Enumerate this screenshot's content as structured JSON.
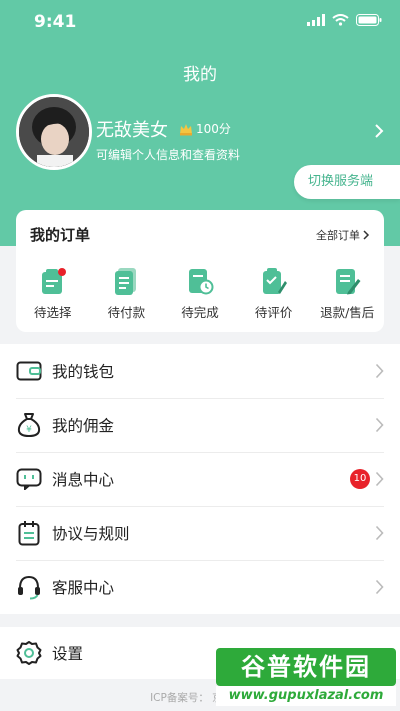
{
  "status_bar": {
    "time": "9:41"
  },
  "header": {
    "title": "我的"
  },
  "profile": {
    "name": "无敌美女",
    "points": "100分",
    "subtitle": "可编辑个人信息和查看资料"
  },
  "switch_button": "切换服务端",
  "orders": {
    "title": "我的订单",
    "all_label": "全部订单",
    "items": [
      {
        "label": "待选择",
        "icon": "pending-select-icon"
      },
      {
        "label": "待付款",
        "icon": "pending-payment-icon"
      },
      {
        "label": "待完成",
        "icon": "pending-complete-icon"
      },
      {
        "label": "待评价",
        "icon": "pending-review-icon"
      },
      {
        "label": "退款/售后",
        "icon": "refund-icon"
      }
    ]
  },
  "menu": {
    "items": [
      {
        "label": "我的钱包",
        "icon": "wallet-icon"
      },
      {
        "label": "我的佣金",
        "icon": "money-bag-icon"
      },
      {
        "label": "消息中心",
        "icon": "message-icon",
        "badge": "10"
      },
      {
        "label": "协议与规则",
        "icon": "calendar-icon"
      },
      {
        "label": "客服中心",
        "icon": "headset-icon"
      }
    ]
  },
  "settings": {
    "label": "设置",
    "icon": "gear-icon"
  },
  "footer": {
    "icp": "ICP备案号： 京ICP备"
  },
  "watermark": {
    "top": "谷普软件园",
    "bottom": "www.gupuxlazal.com"
  },
  "colors": {
    "accent": "#62c9a6",
    "badge": "#e8222a"
  }
}
